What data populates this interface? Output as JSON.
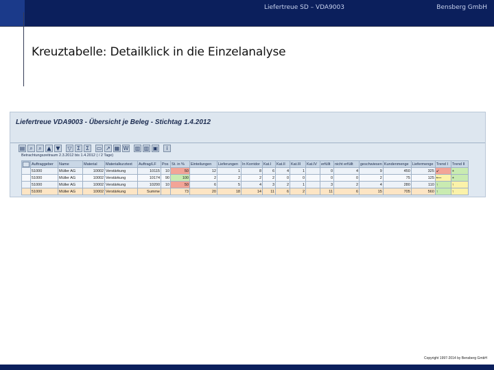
{
  "header": {
    "title": "Liefertreue SD – VDA9003",
    "company": "Bensberg GmbH"
  },
  "slide_title": "Kreuztabelle: Detailklick in die Einzelanalyse",
  "sap": {
    "window_title": "Liefertreue VDA9003 - Übersicht je Beleg - Stichtag 1.4.2012",
    "period_text": "Betrachtungszeitraum 2.3.2012 bis 1.4.2012  (  /  2 Tage)",
    "toolbar_icons": [
      "detail-icon",
      "find-icon",
      "find-next-icon",
      "sort-asc-icon",
      "sort-desc-icon",
      "filter-icon",
      "sum-icon",
      "subtotal-icon",
      "print-icon",
      "export-icon",
      "spreadsheet-icon",
      "word-icon",
      "layout-icon",
      "choose-layout-icon",
      "save-layout-icon",
      "info-icon"
    ],
    "columns": [
      "Auftraggeber",
      "Name",
      "Material",
      "Materialkurztext",
      "Auftrag/LF",
      "Pos",
      "St. in %",
      "Einteilungen",
      "Lieferungen",
      "In Korridor",
      "Kat.I",
      "Kat.II",
      "Kat.III",
      "Kat.IV",
      "erfüllt",
      "nicht erfüllt",
      "geschwiesen",
      "Kundenmenge",
      "Liefermenge",
      "Trend I",
      "Trend II"
    ],
    "rows": [
      [
        "51000",
        "Müller AG",
        "10002",
        "Verstärkung",
        "10115",
        "10",
        "50",
        "12",
        "1",
        "8",
        "6",
        "4",
        "1",
        "",
        "0",
        "4",
        "9",
        "450",
        "325",
        "↙",
        "+"
      ],
      [
        "51000",
        "Müller AG",
        "10002",
        "Verstärkung",
        "10174",
        "90",
        "100",
        "2",
        "2",
        "2",
        "2",
        "0",
        "0",
        "",
        "0",
        "0",
        "2",
        "75",
        "125",
        "⟵",
        "+"
      ],
      [
        "51000",
        "Müller AG",
        "10002",
        "Verstärkung",
        "10200",
        "10",
        "50",
        "6",
        "5",
        "4",
        "3",
        "2",
        "1",
        "",
        "3",
        "2",
        "4",
        "280",
        "110",
        "↑",
        "↑"
      ]
    ],
    "sum_row": [
      "51000",
      "Müller AG",
      "10002",
      "Verstärkung",
      "Summe",
      "",
      "73",
      "20",
      "18",
      "14",
      "11",
      "6",
      "2",
      "",
      "11",
      "6",
      "15",
      "705",
      "560",
      "↑",
      "↑"
    ]
  },
  "copyright": "Copyright 1997-2014 by Bensberg GmbH",
  "colors": {
    "header_navy": "#0b1f5c",
    "cell_red": "#f2a497",
    "cell_green": "#c9ebb1",
    "cell_yellow": "#fbf2a9",
    "sum_row": "#fde5c4"
  }
}
